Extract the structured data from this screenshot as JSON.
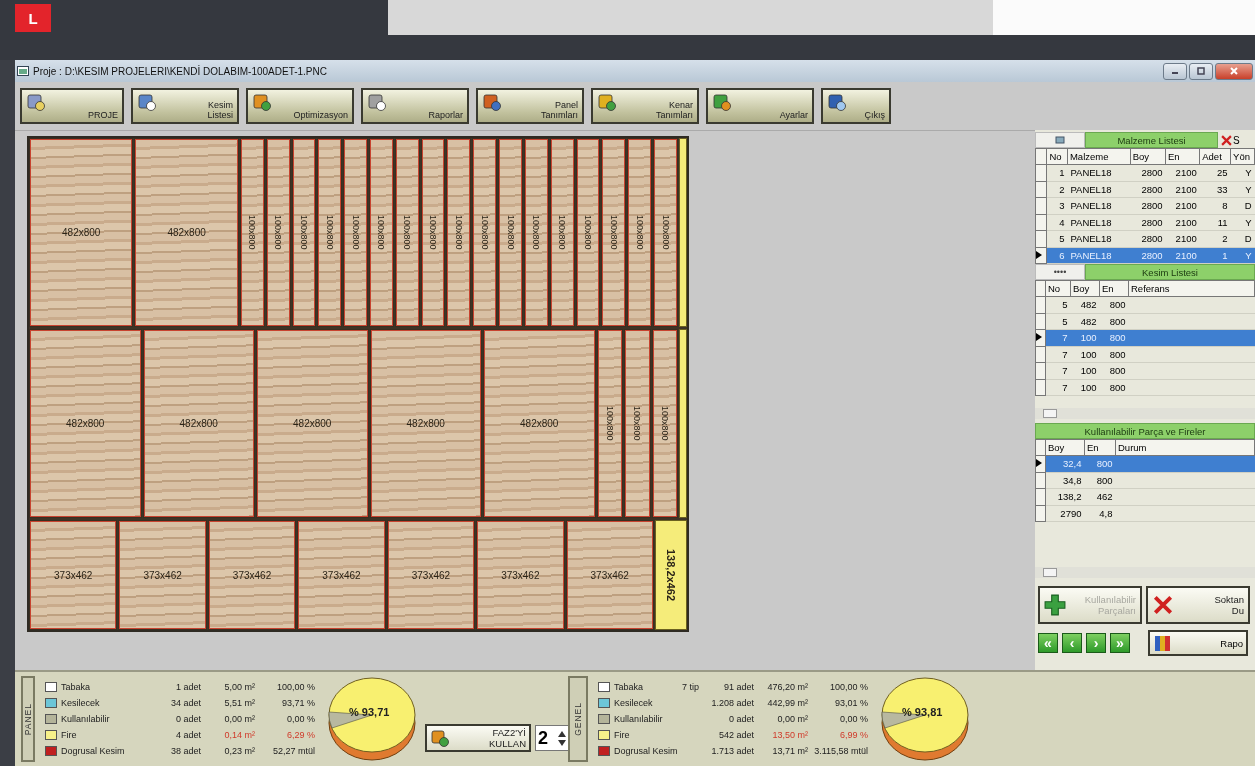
{
  "top_badge": "L",
  "window": {
    "title": "Proje : D:\\KESIM PROJELERI\\KENDİ DOLABIM-100ADET-1.PNC"
  },
  "toolbar": [
    {
      "kind": "project",
      "lines": [
        "PROJE"
      ]
    },
    {
      "kind": "list",
      "lines": [
        "Kesim",
        "Listesi"
      ]
    },
    {
      "kind": "optimize",
      "lines": [
        "Optimizasyon"
      ]
    },
    {
      "kind": "print",
      "lines": [
        "Raporlar"
      ]
    },
    {
      "kind": "panel",
      "lines": [
        "Panel",
        "Tanımları"
      ]
    },
    {
      "kind": "edge",
      "lines": [
        "Kenar",
        "Tanımları"
      ]
    },
    {
      "kind": "settings",
      "lines": [
        "Ayarlar"
      ]
    },
    {
      "kind": "exit",
      "lines": [
        "Çıkış"
      ]
    }
  ],
  "layout": {
    "rows": [
      {
        "kind": "tall",
        "offcut": {
          "kind": "thin"
        },
        "pieces": [
          {
            "kind": "wide",
            "label": "482x800"
          },
          {
            "kind": "wide",
            "label": "482x800"
          },
          {
            "kind": "strip",
            "label": "100x800"
          },
          {
            "kind": "strip",
            "label": "100x800"
          },
          {
            "kind": "strip",
            "label": "100x800"
          },
          {
            "kind": "strip",
            "label": "100x800"
          },
          {
            "kind": "strip",
            "label": "100x800"
          },
          {
            "kind": "strip",
            "label": "100x800"
          },
          {
            "kind": "strip",
            "label": "100x800"
          },
          {
            "kind": "strip",
            "label": "100x800"
          },
          {
            "kind": "strip",
            "label": "100x800"
          },
          {
            "kind": "strip",
            "label": "100x800"
          },
          {
            "kind": "strip",
            "label": "100x800"
          },
          {
            "kind": "strip",
            "label": "100x800"
          },
          {
            "kind": "strip",
            "label": "100x800"
          },
          {
            "kind": "strip",
            "label": "100x800"
          },
          {
            "kind": "strip",
            "label": "100x800"
          },
          {
            "kind": "strip",
            "label": "100x800"
          },
          {
            "kind": "strip",
            "label": "100x800"
          }
        ]
      },
      {
        "kind": "tall",
        "offcut": {
          "kind": "thin"
        },
        "pieces": [
          {
            "kind": "wide",
            "label": "482x800"
          },
          {
            "kind": "wide",
            "label": "482x800"
          },
          {
            "kind": "wide",
            "label": "482x800"
          },
          {
            "kind": "wide",
            "label": "482x800"
          },
          {
            "kind": "wide",
            "label": "482x800"
          },
          {
            "kind": "strip",
            "label": "100x800"
          },
          {
            "kind": "strip",
            "label": "100x800"
          },
          {
            "kind": "strip",
            "label": "100x800"
          }
        ]
      },
      {
        "kind": "short",
        "offcut": {
          "kind": "wide",
          "label": "138,2x462"
        },
        "pieces": [
          {
            "kind": "short",
            "label": "373x462"
          },
          {
            "kind": "short",
            "label": "373x462"
          },
          {
            "kind": "short",
            "label": "373x462"
          },
          {
            "kind": "short",
            "label": "373x462"
          },
          {
            "kind": "short",
            "label": "373x462"
          },
          {
            "kind": "short",
            "label": "373x462"
          },
          {
            "kind": "short",
            "label": "373x462"
          }
        ]
      }
    ]
  },
  "material_list": {
    "title": "Malzeme Listesi",
    "close_label": "S",
    "columns": [
      "No",
      "Malzeme",
      "Boy",
      "En",
      "Adet",
      "Yön"
    ],
    "rows": [
      {
        "cells": [
          "1",
          "PANEL18",
          "2800",
          "2100",
          "25",
          "Y"
        ],
        "selected": false
      },
      {
        "cells": [
          "2",
          "PANEL18",
          "2800",
          "2100",
          "33",
          "Y"
        ],
        "selected": false
      },
      {
        "cells": [
          "3",
          "PANEL18",
          "2800",
          "2100",
          "8",
          "D"
        ],
        "selected": false
      },
      {
        "cells": [
          "4",
          "PANEL18",
          "2800",
          "2100",
          "11",
          "Y"
        ],
        "selected": false
      },
      {
        "cells": [
          "5",
          "PANEL18",
          "2800",
          "2100",
          "2",
          "D"
        ],
        "selected": false
      },
      {
        "cells": [
          "6",
          "PANEL18",
          "2800",
          "2100",
          "1",
          "Y"
        ],
        "selected": true
      }
    ]
  },
  "cut_list": {
    "button": "••••",
    "title": "Kesim Listesi",
    "columns": [
      "No",
      "Boy",
      "En",
      "Referans"
    ],
    "rows": [
      {
        "cells": [
          "5",
          "482",
          "800",
          ""
        ],
        "selected": false
      },
      {
        "cells": [
          "5",
          "482",
          "800",
          ""
        ],
        "selected": false
      },
      {
        "cells": [
          "7",
          "100",
          "800",
          ""
        ],
        "selected": true
      },
      {
        "cells": [
          "7",
          "100",
          "800",
          ""
        ],
        "selected": false
      },
      {
        "cells": [
          "7",
          "100",
          "800",
          ""
        ],
        "selected": false
      },
      {
        "cells": [
          "7",
          "100",
          "800",
          ""
        ],
        "selected": false
      }
    ]
  },
  "offcuts": {
    "title": "Kullanılabilir Parça ve Fireler",
    "columns": [
      "Boy",
      "En",
      "Durum"
    ],
    "rows": [
      {
        "cells": [
          "32,4",
          "800",
          ""
        ],
        "selected": true
      },
      {
        "cells": [
          "34,8",
          "800",
          ""
        ],
        "selected": false
      },
      {
        "cells": [
          "138,2",
          "462",
          ""
        ],
        "selected": false
      },
      {
        "cells": [
          "2790",
          "4,8",
          ""
        ],
        "selected": false
      }
    ]
  },
  "actions": [
    {
      "kind": "add",
      "lines": [
        "Kullanılabilir",
        "Parçaları"
      ],
      "disabled": true
    },
    {
      "kind": "delete",
      "lines": [
        "Soktan",
        "Du"
      ],
      "disabled": false
    }
  ],
  "nav": [
    "«",
    "‹",
    "›",
    "»"
  ],
  "report_button": {
    "label": "Rapo"
  },
  "stats": [
    {
      "title": "PANEL",
      "pie_label": "% 93,71",
      "items": [
        {
          "name": "Tabaka",
          "color": "#ffffff",
          "count": "1 adet",
          "area": "5,00 m²",
          "ratio": "100,00 %",
          "alert": false
        },
        {
          "name": "Kesilecek",
          "color": "#6cc6d8",
          "count": "34 adet",
          "area": "5,51 m²",
          "ratio": "93,71 %",
          "alert": false
        },
        {
          "name": "Kullanılabilir",
          "color": "#b4b49a",
          "count": "0 adet",
          "area": "0,00 m²",
          "ratio": "0,00 %",
          "alert": false
        },
        {
          "name": "Fire",
          "color": "#f6f08a",
          "count": "4 adet",
          "area": "0,14 m²",
          "ratio": "6,29 %",
          "alert": true
        },
        {
          "name": "Dogrusal Kesim",
          "color": "#c02020",
          "count": "38 adet",
          "area": "0,23 m²",
          "ratio": "52,27 mtül",
          "alert": false
        }
      ]
    },
    {
      "title": "GENEL",
      "pie_label": "% 93,81",
      "items": [
        {
          "name": "Tabaka",
          "note": "7 tip",
          "color": "#ffffff",
          "count": "91 adet",
          "area": "476,20 m²",
          "ratio": "100,00 %",
          "alert": false
        },
        {
          "name": "Kesilecek",
          "color": "#6cc6d8",
          "count": "1.208 adet",
          "area": "442,99 m²",
          "ratio": "93,01 %",
          "alert": false
        },
        {
          "name": "Kullanılabilir",
          "color": "#b4b49a",
          "count": "0 adet",
          "area": "0,00 m²",
          "ratio": "0,00 %",
          "alert": false
        },
        {
          "name": "Fire",
          "color": "#f6f08a",
          "count": "542 adet",
          "area": "13,50 m²",
          "ratio": "6,99 %",
          "alert": true
        },
        {
          "name": "Dogrusal Kesim",
          "color": "#c02020",
          "count": "1.713 adet",
          "area": "13,71 m²",
          "ratio": "3.115,58 mtül",
          "alert": false
        }
      ]
    }
  ],
  "faz2": {
    "lines": [
      "FAZ2'Yİ",
      "KULLAN"
    ],
    "spinner": "2"
  }
}
